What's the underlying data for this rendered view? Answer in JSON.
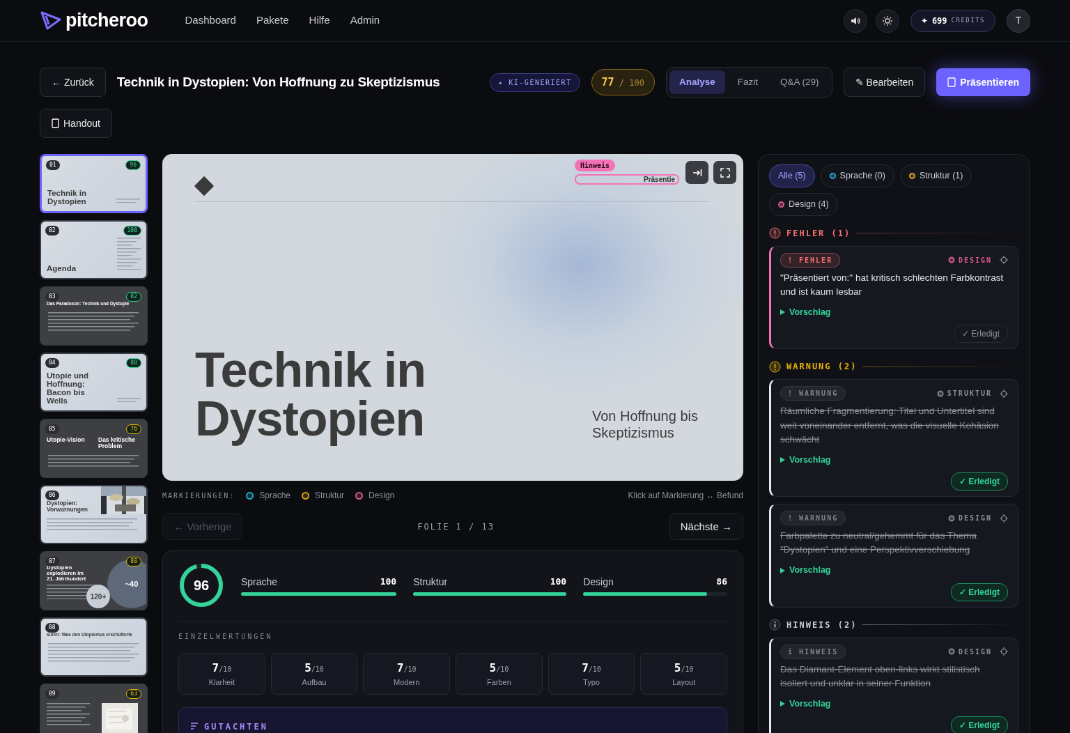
{
  "brand": "pitcheroo",
  "nav": [
    {
      "label": "Dashboard"
    },
    {
      "label": "Pakete"
    },
    {
      "label": "Hilfe"
    },
    {
      "label": "Admin"
    }
  ],
  "credits": {
    "icon": "✦",
    "amount": "699",
    "unit": "CREDITS"
  },
  "avatar": "T",
  "back_button": "← Zurück",
  "title": "Technik in Dystopien: Von Hoffnung zu Skeptizismus",
  "ai_badge": "✦ KI-GENERIERT",
  "score": {
    "value": "77",
    "max": "/ 100"
  },
  "tabs": [
    {
      "label": "Analyse",
      "selected": true
    },
    {
      "label": "Fazit",
      "selected": false
    },
    {
      "label": "Q&A (29)",
      "selected": false
    }
  ],
  "edit_button": "✎ Bearbeiten",
  "present_button": "Präsentieren",
  "handout_button": "Handout",
  "thumbnails": [
    {
      "number": "01",
      "score": "96",
      "color": "#34d399",
      "dark": false,
      "kind": "cover",
      "selected": true,
      "titles": [
        "Technik in Dystopien"
      ]
    },
    {
      "number": "02",
      "score": "100",
      "color": "#34d399",
      "dark": false,
      "kind": "cover",
      "selected": false,
      "titles": [
        "Agenda"
      ]
    },
    {
      "number": "03",
      "score": "82",
      "color": "#34d399",
      "dark": true,
      "kind": "content",
      "selected": false,
      "titles": [
        "Das Paradoxon: Technik und Dystopie"
      ]
    },
    {
      "number": "04",
      "score": "88",
      "color": "#34d399",
      "dark": false,
      "kind": "cover",
      "selected": false,
      "titles": [
        "Utopie und Hoffnung: Bacon bis Wells"
      ]
    },
    {
      "number": "05",
      "score": "76",
      "color": "#eab308",
      "dark": true,
      "kind": "content",
      "selected": false,
      "titles": [
        "Utopie-Vision",
        "Das kritische Problem"
      ]
    },
    {
      "number": "06",
      "dark": false,
      "selected": false,
      "titles": [
        "Dystopien: Vorwarnungen"
      ]
    },
    {
      "number": "07",
      "score": "80",
      "color": "#eab308",
      "dark": true,
      "kind": "stats",
      "selected": false,
      "titles": [
        "Dystopien explodieren im 21. Jahrhundert"
      ],
      "stats": [
        "~40",
        "120+"
      ]
    },
    {
      "number": "08",
      "dark": false,
      "kind": "content",
      "selected": false,
      "titles": [
        "suren: Was den Utopismus erschütterte"
      ]
    },
    {
      "number": "09",
      "score": "63",
      "color": "#eab308",
      "dark": true,
      "selected": false
    }
  ],
  "slide": {
    "tag": "Hinweis",
    "marked_text": "Präsentie",
    "title": "Technik in Dystopien",
    "subtitle": "Von Hoffnung bis Skeptizismus"
  },
  "legend": {
    "label": "MARKIERUNGEN:",
    "items": [
      {
        "label": "Sprache",
        "color": "#22a6c9"
      },
      {
        "label": "Struktur",
        "color": "#d4a017"
      },
      {
        "label": "Design",
        "color": "#d9578f"
      }
    ],
    "hint": "Klick auf Markierung ↔ Befund"
  },
  "pager": {
    "prev": "← Vorherige",
    "prev_disabled": true,
    "position": "FOLIE 1 / 13",
    "next": "Nächste →"
  },
  "scores": {
    "total": "96",
    "level": 0.96,
    "bars": [
      {
        "label": "Sprache",
        "value": "100",
        "level": 1
      },
      {
        "label": "Struktur",
        "value": "100",
        "level": 1
      },
      {
        "label": "Design",
        "value": "86",
        "level": 0.86
      }
    ]
  },
  "ratings": {
    "heading": "EINZELWERTUNGEN",
    "items": [
      {
        "score": "7",
        "max": "/10",
        "label": "Klarheit"
      },
      {
        "score": "5",
        "max": "/10",
        "label": "Aufbau"
      },
      {
        "score": "7",
        "max": "/10",
        "label": "Modern"
      },
      {
        "score": "5",
        "max": "/10",
        "label": "Farben"
      },
      {
        "score": "7",
        "max": "/10",
        "label": "Typo"
      },
      {
        "score": "5",
        "max": "/10",
        "label": "Layout"
      }
    ]
  },
  "report": {
    "heading": "GUTACHTEN"
  },
  "filters": [
    {
      "label": "Alle (5)",
      "selected": true
    },
    {
      "label": "Sprache (0)",
      "color": "#22a6c9",
      "selected": false
    },
    {
      "label": "Struktur (1)",
      "color": "#d4a017",
      "selected": false
    },
    {
      "label": "Design (4)",
      "color": "#d9578f",
      "selected": false
    }
  ],
  "groups": [
    {
      "kind": "error",
      "title": "FEHLER (1)",
      "issues": [
        {
          "badge": "! FEHLER",
          "category": "DESIGN",
          "color": "#d9578f",
          "text": "\"Präsentiert von:\" hat kritisch schlechten Farbkontrast und ist kaum lesbar",
          "suggestion": "Vorschlag",
          "done": false,
          "done_label": "✓ Erledigt"
        }
      ]
    },
    {
      "kind": "warning",
      "title": "WARNUNG (2)",
      "issues": [
        {
          "badge": "! WARNUNG",
          "category": "STRUKTUR",
          "text": "Räumliche Fragmentierung: Titel und Untertitel sind weit voneinander entfernt, was die visuelle Kohäsion schwächt",
          "suggestion": "Vorschlag",
          "done": true,
          "done_label": "✓ Erledigt"
        },
        {
          "badge": "! WARNUNG",
          "category": "DESIGN",
          "text": "Farbpalette zu neutral/gehemmt für das Thema \"Dystopien\" und eine Perspektivverschiebung",
          "suggestion": "Vorschlag",
          "done": true,
          "done_label": "✓ Erledigt"
        }
      ]
    },
    {
      "kind": "info",
      "title": "HINWEIS (2)",
      "issues": [
        {
          "badge": "i HINWEIS",
          "category": "DESIGN",
          "text": "Das Diamant-Element oben-links wirkt stilistisch isoliert und unklar in seiner Funktion",
          "suggestion": "Vorschlag",
          "done": true,
          "done_label": "✓ Erledigt"
        }
      ]
    }
  ]
}
